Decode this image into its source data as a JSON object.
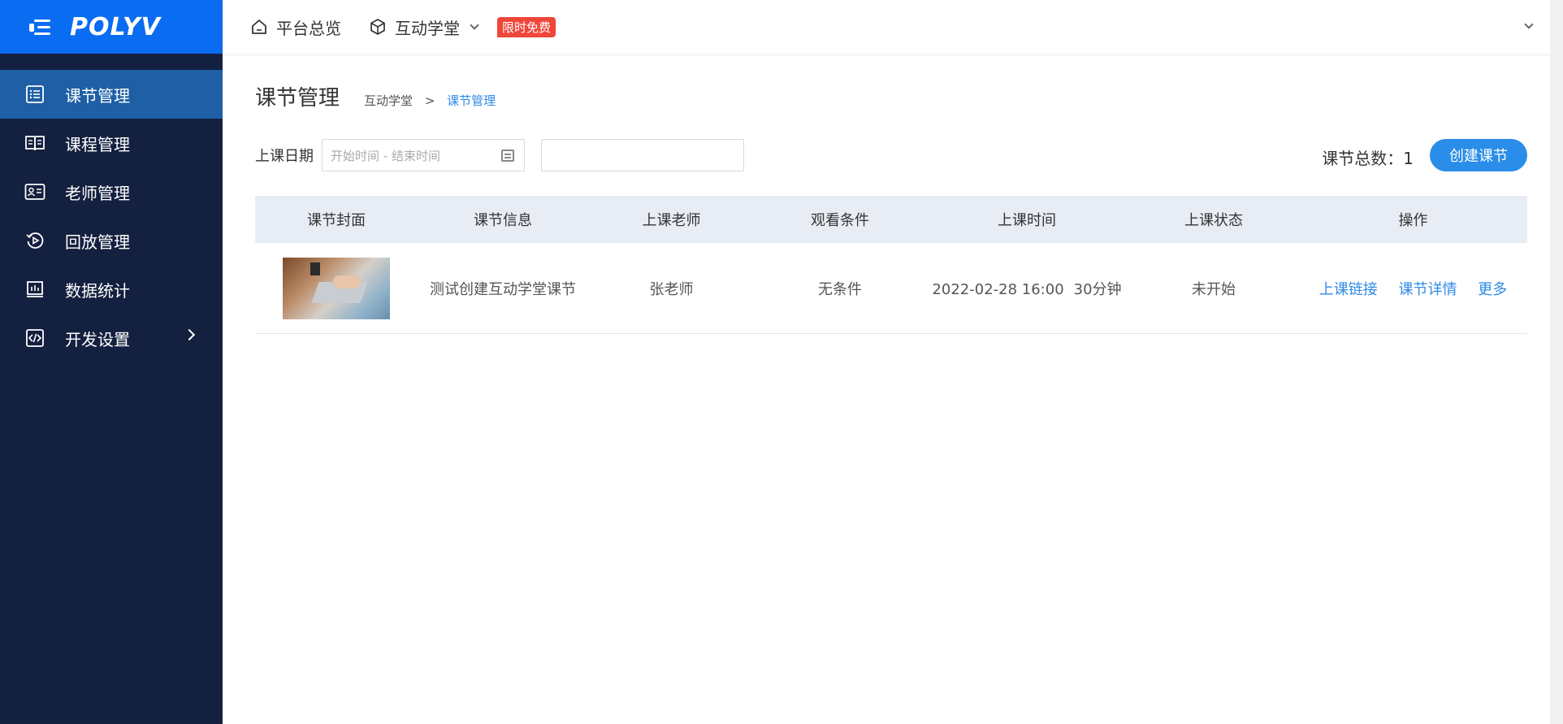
{
  "brand": {
    "logo_text": "POLYV",
    "accent": "#0a6cf0"
  },
  "sidebar": {
    "items": [
      {
        "label": "课节管理",
        "icon": "list-icon",
        "active": true
      },
      {
        "label": "课程管理",
        "icon": "book-icon",
        "active": false
      },
      {
        "label": "老师管理",
        "icon": "id-card-icon",
        "active": false
      },
      {
        "label": "回放管理",
        "icon": "replay-icon",
        "active": false
      },
      {
        "label": "数据统计",
        "icon": "chart-icon",
        "active": false
      },
      {
        "label": "开发设置",
        "icon": "code-icon",
        "active": false
      }
    ]
  },
  "topbar": {
    "overview_label": "平台总览",
    "product_label": "互动学堂",
    "badge": "限时免费"
  },
  "page": {
    "title": "课节管理",
    "breadcrumb": [
      "互动学堂",
      ">",
      "课节管理"
    ]
  },
  "filter": {
    "date_label": "上课日期",
    "date_placeholder": "开始时间 - 结束时间",
    "search_value": "",
    "total_label": "课节总数：",
    "total_count": "1",
    "create_label": "创建课节"
  },
  "table": {
    "headers": [
      "课节封面",
      "课节信息",
      "上课老师",
      "观看条件",
      "上课时间",
      "上课状态",
      "操作"
    ],
    "rows": [
      {
        "info": "测试创建互动学堂课节",
        "teacher": "张老师",
        "condition": "无条件",
        "time": "2022-02-28 16:00",
        "duration": "30分钟",
        "status": "未开始",
        "actions": [
          "上课链接",
          "课节详情",
          "更多"
        ]
      }
    ]
  }
}
